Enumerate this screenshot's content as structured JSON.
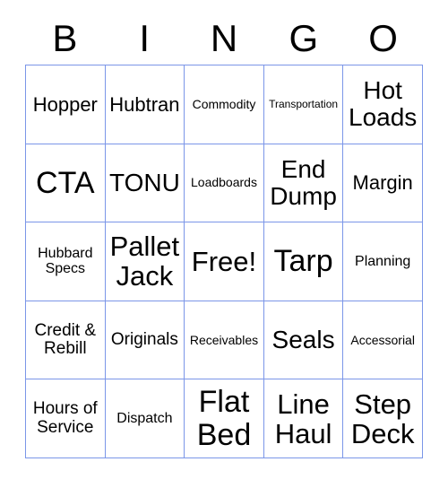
{
  "card": {
    "title": "BINGO",
    "border_color": "#7b96e8",
    "text_color": "#000000",
    "background_color": "#ffffff",
    "columns": 5,
    "rows": 5,
    "header": {
      "letters": [
        "B",
        "I",
        "N",
        "G",
        "O"
      ]
    },
    "free_space": {
      "label": "Free!",
      "row": 3,
      "column": 3
    },
    "cells": [
      [
        {
          "label": "Hopper",
          "size": "fs-xl"
        },
        {
          "label": "Hubtran",
          "size": "fs-xl"
        },
        {
          "label": "Commodity",
          "size": "fs-sm"
        },
        {
          "label": "Transportation",
          "size": "fs-xs"
        },
        {
          "label": "Hot Loads",
          "size": "fs-3xl"
        }
      ],
      [
        {
          "label": "CTA",
          "size": "fs-5xl"
        },
        {
          "label": "TONU",
          "size": "fs-3xl"
        },
        {
          "label": "Loadboards",
          "size": "fs-sm"
        },
        {
          "label": "End Dump",
          "size": "fs-3xl"
        },
        {
          "label": "Margin",
          "size": "fs-xl"
        }
      ],
      [
        {
          "label": "Hubbard Specs",
          "size": "fs-md"
        },
        {
          "label": "Pallet Jack",
          "size": "fs-4xl"
        },
        {
          "label": "Free!",
          "size": "fs-4xl"
        },
        {
          "label": "Tarp",
          "size": "fs-5xl"
        },
        {
          "label": "Planning",
          "size": "fs-md"
        }
      ],
      [
        {
          "label": "Credit & Rebill",
          "size": "fs-lg"
        },
        {
          "label": "Originals",
          "size": "fs-lg"
        },
        {
          "label": "Receivables",
          "size": "fs-sm"
        },
        {
          "label": "Seals",
          "size": "fs-3xl"
        },
        {
          "label": "Accessorial",
          "size": "fs-sm"
        }
      ],
      [
        {
          "label": "Hours of Service",
          "size": "fs-lg"
        },
        {
          "label": "Dispatch",
          "size": "fs-md"
        },
        {
          "label": "Flat Bed",
          "size": "fs-5xl"
        },
        {
          "label": "Line Haul",
          "size": "fs-4xl"
        },
        {
          "label": "Step Deck",
          "size": "fs-4xl"
        }
      ]
    ]
  }
}
